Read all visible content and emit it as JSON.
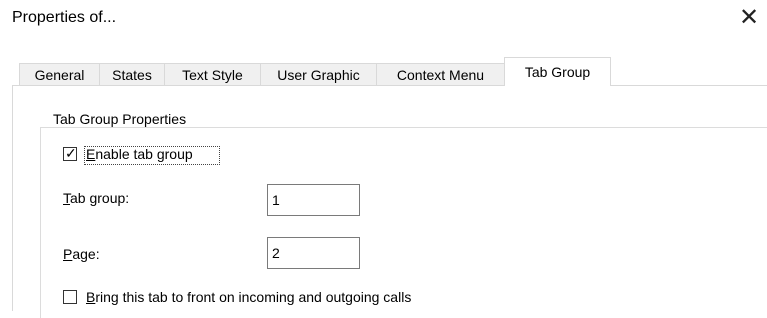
{
  "dialog": {
    "title": "Properties of...",
    "close_glyph": "✕"
  },
  "tabs": [
    {
      "label": "General",
      "active": false
    },
    {
      "label": "States",
      "active": false
    },
    {
      "label": "Text Style",
      "active": false
    },
    {
      "label": "User Graphic",
      "active": false
    },
    {
      "label": "Context Menu",
      "active": false
    },
    {
      "label": "Tab Group",
      "active": true
    }
  ],
  "group": {
    "title": "Tab Group Properties",
    "enable_checkbox": {
      "label_accel": "E",
      "label_rest": "nable tab group",
      "checked": true
    },
    "tab_group": {
      "label_accel": "T",
      "label_rest": "ab group:",
      "value": "1"
    },
    "page": {
      "label_accel": "P",
      "label_rest": "age:",
      "value": "2"
    },
    "bring_checkbox": {
      "label_accel": "B",
      "label_rest": "ring this tab to front on incoming and outgoing calls",
      "checked": false
    }
  }
}
